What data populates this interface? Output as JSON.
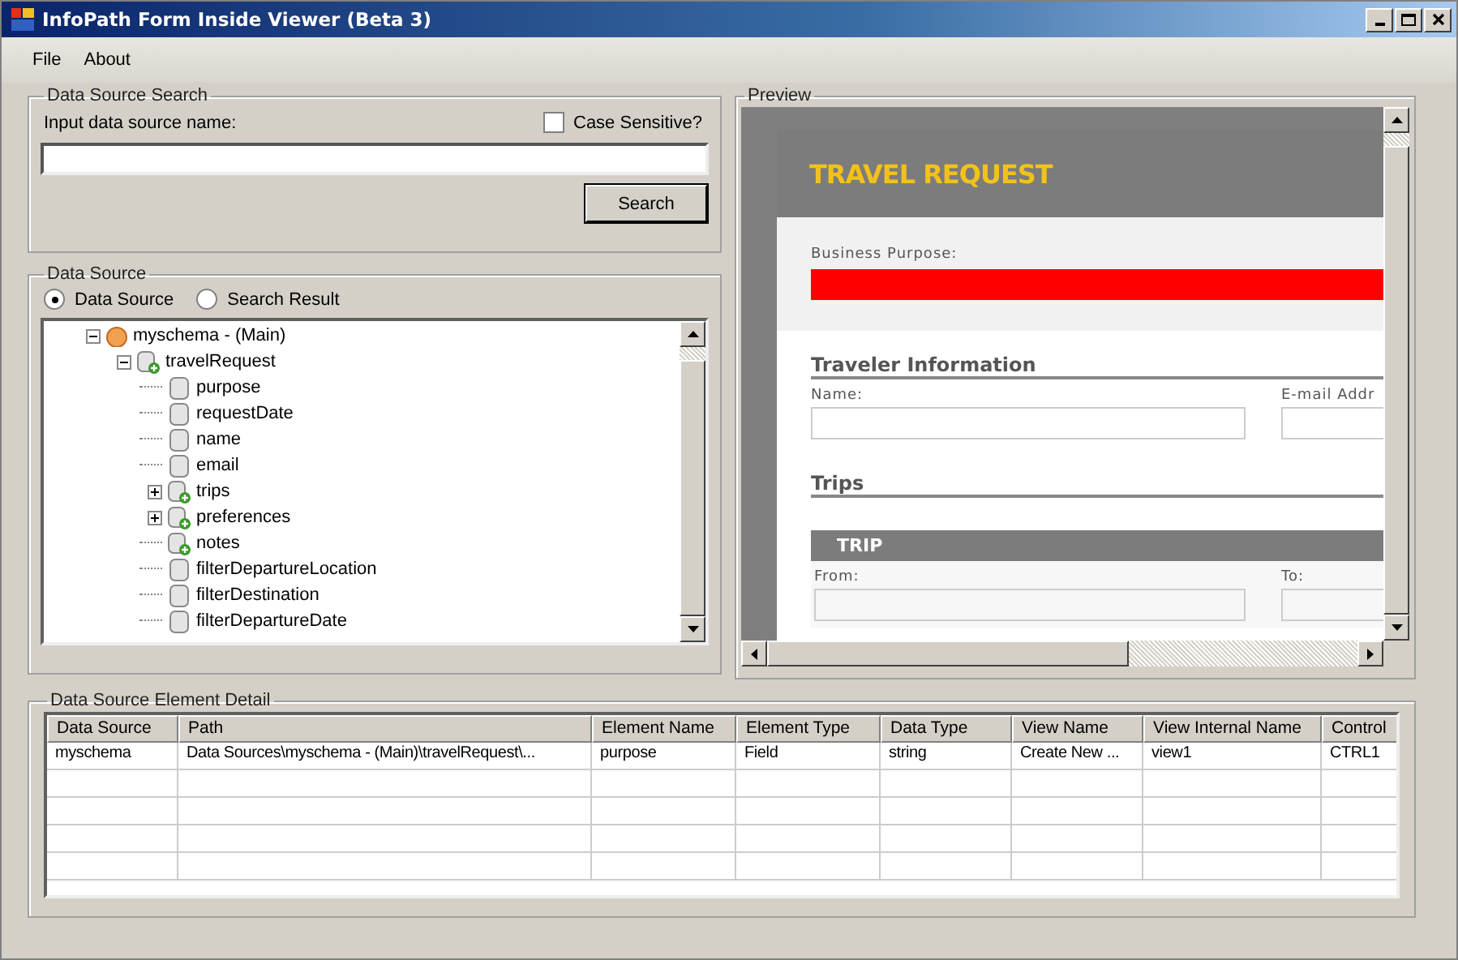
{
  "window": {
    "title": "InfoPath Form Inside Viewer (Beta 3)"
  },
  "menu": [
    "File",
    "About"
  ],
  "search": {
    "group_title": "Data Source Search",
    "label": "Input data source name:",
    "case_sensitive": {
      "label": "Case Sensitive?",
      "checked": false
    },
    "button": "Search"
  },
  "data_source": {
    "group_title": "Data Source",
    "options": [
      {
        "label": "Data Source",
        "selected": true
      },
      {
        "label": "Search Result",
        "selected": false
      }
    ],
    "tree": [
      {
        "label": "myschema - (Main)",
        "kind": "root",
        "expanded": true,
        "children": [
          {
            "label": "travelRequest",
            "kind": "group",
            "expanded": true,
            "children": [
              {
                "label": "purpose",
                "kind": "field"
              },
              {
                "label": "requestDate",
                "kind": "field"
              },
              {
                "label": "name",
                "kind": "field"
              },
              {
                "label": "email",
                "kind": "field"
              },
              {
                "label": "trips",
                "kind": "group",
                "expanded": false
              },
              {
                "label": "preferences",
                "kind": "group",
                "expanded": false
              },
              {
                "label": "notes",
                "kind": "group"
              },
              {
                "label": "filterDepartureLocation",
                "kind": "field"
              },
              {
                "label": "filterDestination",
                "kind": "field"
              },
              {
                "label": "filterDepartureDate",
                "kind": "field"
              }
            ]
          }
        ]
      }
    ]
  },
  "preview": {
    "group_title": "Preview",
    "heading": "TRAVEL REQUEST",
    "purpose": {
      "label": "Business Purpose:",
      "invalid": true
    },
    "traveler": {
      "heading": "Traveler Information",
      "fields": [
        {
          "label": "Name:"
        },
        {
          "label": "E-mail Addr"
        }
      ]
    },
    "trips": {
      "heading": "Trips",
      "trip_title": "TRIP",
      "fields": [
        {
          "label": "From:"
        },
        {
          "label": "To:"
        }
      ]
    }
  },
  "detail": {
    "group_title": "Data Source Element Detail",
    "columns": [
      "Data Source",
      "Path",
      "Element Name",
      "Element Type",
      "Data Type",
      "View Name",
      "View Internal Name",
      "Control"
    ],
    "rows": [
      [
        "myschema",
        "Data Sources\\myschema - (Main)\\travelRequest\\...",
        "purpose",
        "Field",
        "string",
        "Create New ...",
        "view1",
        "CTRL1"
      ]
    ]
  }
}
